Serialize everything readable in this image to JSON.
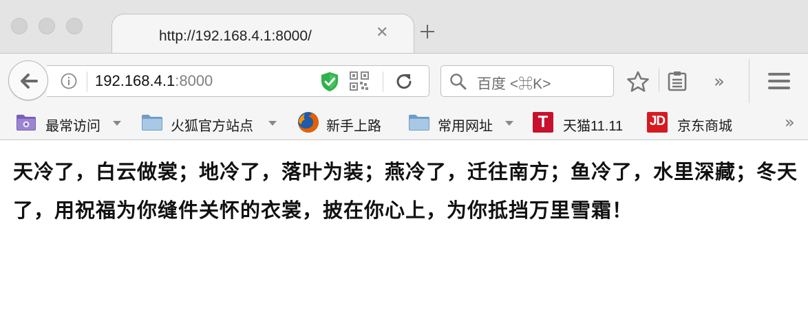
{
  "window": {
    "controls": [
      "close",
      "minimize",
      "maximize"
    ]
  },
  "tab": {
    "title": "http://192.168.4.1:8000/",
    "close_icon": "close-icon",
    "new_tab_icon": "plus-icon"
  },
  "navbar": {
    "url_host": "192.168.4.1",
    "url_port": ":8000",
    "search_placeholder": "百度 <⌘K>",
    "icons": [
      "back-arrow-icon",
      "info-icon",
      "shield-check-icon",
      "qr-code-icon",
      "reload-icon",
      "search-icon",
      "star-icon",
      "reader-list-icon",
      "overflow-chevron-icon",
      "hamburger-menu-icon"
    ],
    "overflow_glyph": "»"
  },
  "bookmarks": {
    "items": [
      {
        "label": "最常访问",
        "icon": "most-visited-folder-icon",
        "has_dropdown": true
      },
      {
        "label": "火狐官方站点",
        "icon": "folder-icon",
        "has_dropdown": true
      },
      {
        "label": "新手上路",
        "icon": "firefox-icon",
        "has_dropdown": false
      },
      {
        "label": "常用网址",
        "icon": "folder-icon",
        "has_dropdown": true
      },
      {
        "label": "天猫11.11",
        "icon": "tmall-icon",
        "has_dropdown": false
      },
      {
        "label": "京东商城",
        "icon": "jd-icon",
        "has_dropdown": false
      }
    ],
    "more_glyph": "»",
    "tmall_glyph": "T",
    "jd_glyph": "JD"
  },
  "content": {
    "text": "天冷了，白云做裳；地冷了，落叶为装；燕冷了，迁往南方；鱼冷了，水里深藏；冬天了，用祝福为你缝件关怀的衣裳，披在你心上，为你抵挡万里雪霜！"
  },
  "colors": {
    "shield": "#2fb14b",
    "tmall": "#c8102e",
    "jd": "#d71920",
    "folder": "#8fb8e0",
    "most_visited": "#7b5fb8"
  }
}
